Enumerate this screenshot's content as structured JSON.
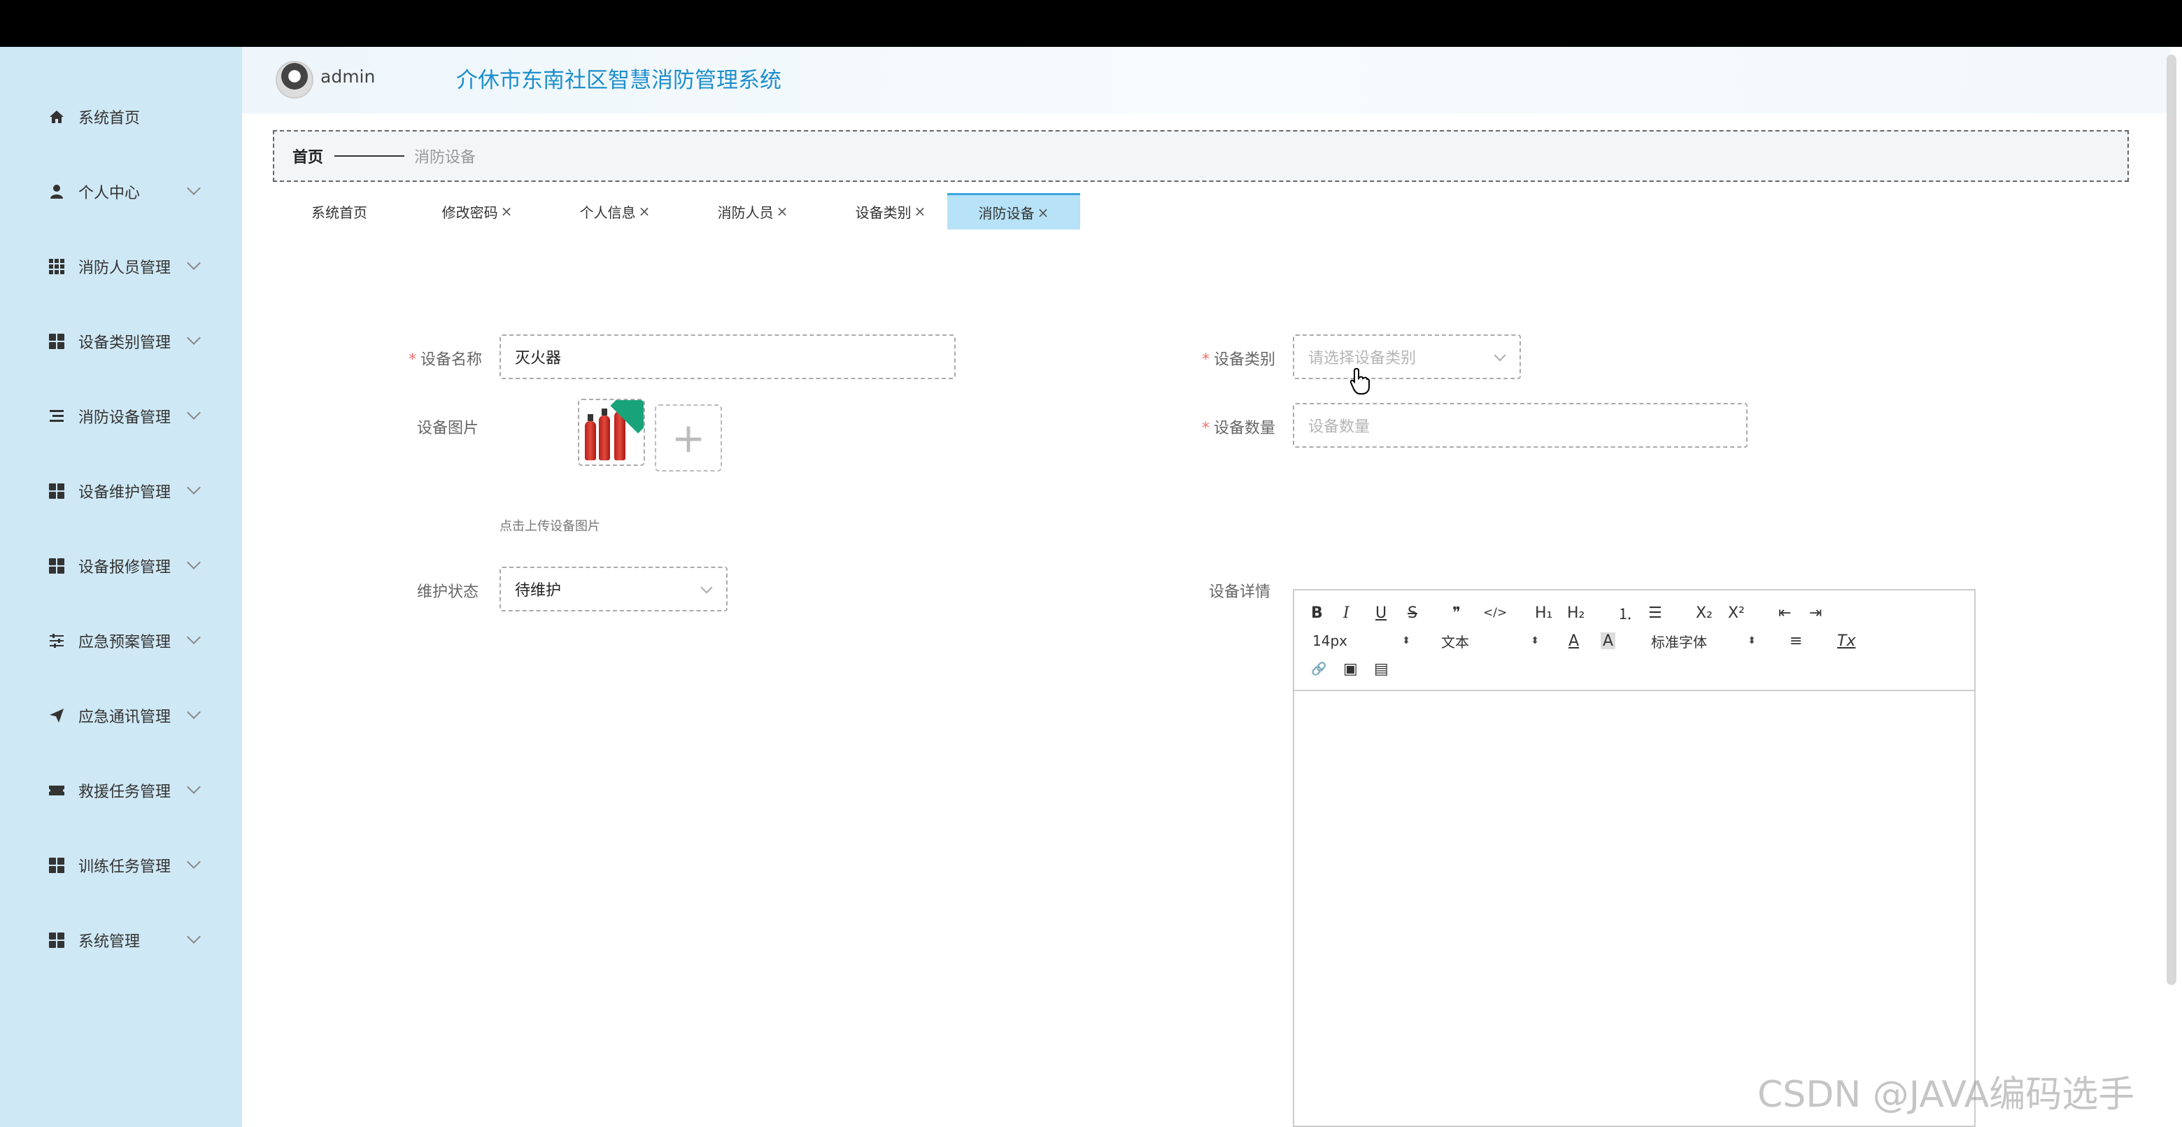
{
  "sidebar": {
    "items": [
      {
        "label": "系统首页",
        "icon": "home-icon"
      },
      {
        "label": "个人中心",
        "icon": "user-icon"
      },
      {
        "label": "消防人员管理",
        "icon": "grid-icon"
      },
      {
        "label": "设备类别管理",
        "icon": "grid-icon"
      },
      {
        "label": "消防设备管理",
        "icon": "list-icon"
      },
      {
        "label": "设备维护管理",
        "icon": "grid-icon"
      },
      {
        "label": "设备报修管理",
        "icon": "grid-icon"
      },
      {
        "label": "应急预案管理",
        "icon": "sliders-icon"
      },
      {
        "label": "应急通讯管理",
        "icon": "send-icon"
      },
      {
        "label": "救援任务管理",
        "icon": "ticket-icon"
      },
      {
        "label": "训练任务管理",
        "icon": "grid-icon"
      },
      {
        "label": "系统管理",
        "icon": "grid-icon"
      }
    ]
  },
  "header": {
    "username": "admin",
    "title": "介休市东南社区智慧消防管理系统"
  },
  "breadcrumb": {
    "home": "首页",
    "current": "消防设备"
  },
  "tabs": [
    {
      "label": "系统首页",
      "closable": false
    },
    {
      "label": "修改密码",
      "closable": true
    },
    {
      "label": "个人信息",
      "closable": true
    },
    {
      "label": "消防人员",
      "closable": true
    },
    {
      "label": "设备类别",
      "closable": true
    },
    {
      "label": "消防设备",
      "closable": true,
      "active": true
    }
  ],
  "tab_close": "×",
  "form": {
    "name_label": "设备名称",
    "name_value": "灭火器",
    "category_label": "设备类别",
    "category_placeholder": "请选择设备类别",
    "image_label": "设备图片",
    "upload_hint": "点击上传设备图片",
    "quantity_label": "设备数量",
    "quantity_placeholder": "设备数量",
    "status_label": "维护状态",
    "status_value": "待维护",
    "detail_label": "设备详情",
    "required_mark": "*",
    "upload_plus": "+"
  },
  "editor": {
    "bold": "B",
    "italic": "I",
    "underline": "U",
    "strike": "S",
    "quote": "❞",
    "code": "</>",
    "h1": "H₁",
    "h2": "H₂",
    "ordered_list": "⒈",
    "bullet_list": "☰",
    "subscript": "X₂",
    "superscript": "X²",
    "outdent": "⇤",
    "indent": "⇥",
    "size": "14px",
    "header_select": "文本",
    "color": "A",
    "background": "A",
    "font": "标准字体",
    "align": "≡",
    "clean": "Tx",
    "link": "🔗",
    "image": "▣",
    "video": "▤"
  },
  "watermark": "CSDN @JAVA编码选手",
  "colors": {
    "sidebar_bg": "#cfe8f5",
    "title": "#1e8fcc",
    "active_tab": "#b7e2f7",
    "required": "#f56c6c"
  }
}
